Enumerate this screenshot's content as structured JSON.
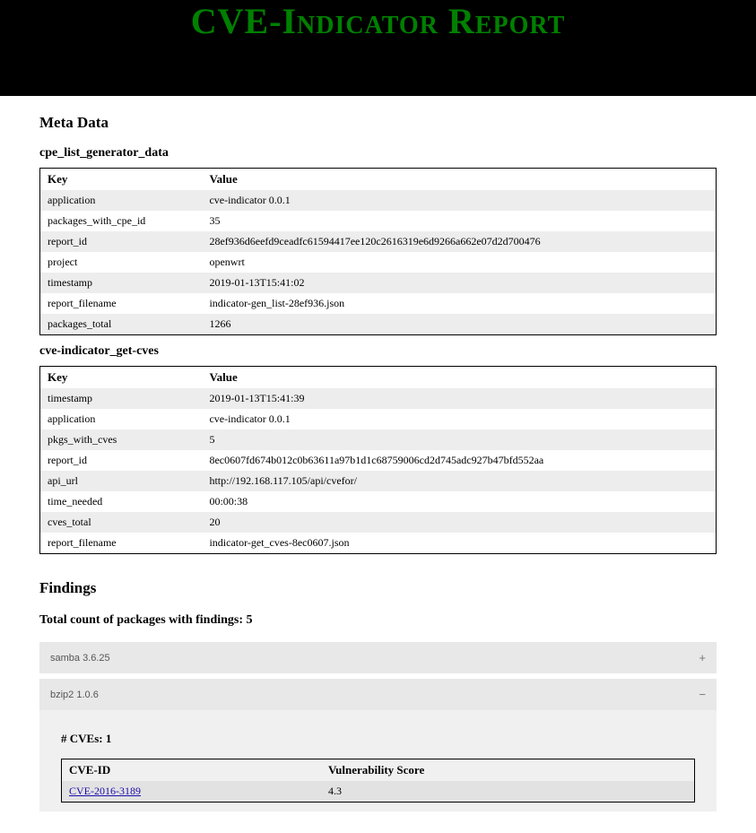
{
  "banner": {
    "title": "CVE-Indicator Report"
  },
  "meta": {
    "heading": "Meta Data",
    "tables": [
      {
        "heading": "cpe_list_generator_data",
        "columns": [
          "Key",
          "Value"
        ],
        "rows": [
          [
            "application",
            "cve-indicator 0.0.1"
          ],
          [
            "packages_with_cpe_id",
            "35"
          ],
          [
            "report_id",
            "28ef936d6eefd9ceadfc61594417ee120c2616319e6d9266a662e07d2d700476"
          ],
          [
            "project",
            "openwrt"
          ],
          [
            "timestamp",
            "2019-01-13T15:41:02"
          ],
          [
            "report_filename",
            "indicator-gen_list-28ef936.json"
          ],
          [
            "packages_total",
            "1266"
          ]
        ]
      },
      {
        "heading": "cve-indicator_get-cves",
        "columns": [
          "Key",
          "Value"
        ],
        "rows": [
          [
            "timestamp",
            "2019-01-13T15:41:39"
          ],
          [
            "application",
            "cve-indicator 0.0.1"
          ],
          [
            "pkgs_with_cves",
            "5"
          ],
          [
            "report_id",
            "8ec0607fd674b012c0b63611a97b1d1c68759006cd2d745adc927b47bfd552aa"
          ],
          [
            "api_url",
            "http://192.168.117.105/api/cvefor/"
          ],
          [
            "time_needed",
            "00:00:38"
          ],
          [
            "cves_total",
            "20"
          ],
          [
            "report_filename",
            "indicator-get_cves-8ec0607.json"
          ]
        ]
      }
    ]
  },
  "findings": {
    "heading": "Findings",
    "total_label": "Total count of packages with findings: 5",
    "items": [
      {
        "title": "samba 3.6.25",
        "expanded": false,
        "toggle": "+"
      },
      {
        "title": "bzip2 1.0.6",
        "expanded": true,
        "toggle": "−",
        "cve_count_label": "# CVEs: 1",
        "cve_columns": [
          "CVE-ID",
          "Vulnerability Score"
        ],
        "cves": [
          {
            "id": "CVE-2016-3189",
            "score": "4.3"
          }
        ]
      }
    ]
  }
}
